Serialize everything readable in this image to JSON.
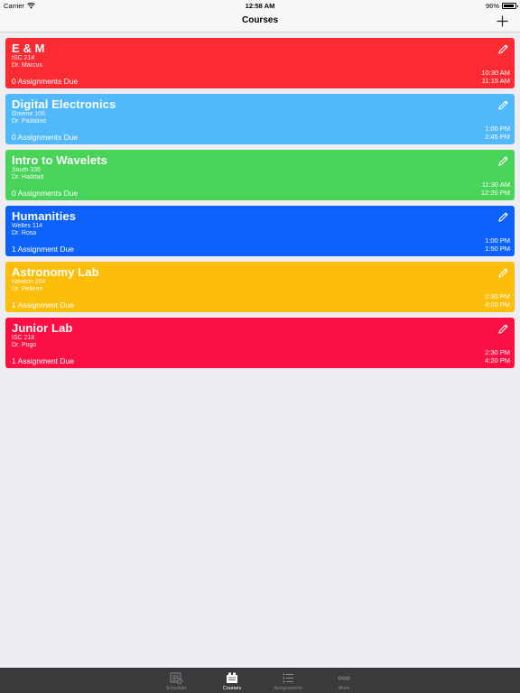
{
  "status": {
    "carrier": "Carrier",
    "time": "12:58 AM",
    "battery": "96%"
  },
  "nav": {
    "title": "Courses",
    "add_icon": "plus-icon"
  },
  "courses": [
    {
      "name": "E & M",
      "room": "ISC 214",
      "professor": "Dr. Marcus",
      "due": "0 Assignments Due",
      "start": "10:30 AM",
      "end": "11:15 AM",
      "color": "#fc2a33"
    },
    {
      "name": "Digital Electronics",
      "room": "Greene 105",
      "professor": "Dr. Padalino",
      "due": "0 Assignments Due",
      "start": "1:00 PM",
      "end": "2:45 PM",
      "color": "#51b8f9"
    },
    {
      "name": "Intro to Wavelets",
      "room": "South 336",
      "professor": "Dr. Haddad",
      "due": "0 Assignments Due",
      "start": "11:30 AM",
      "end": "12:20 PM",
      "color": "#48d359"
    },
    {
      "name": "Humanities",
      "room": "Welles 114",
      "professor": "Dr. Rosa",
      "due": "1 Assignment Due",
      "start": "1:00 PM",
      "end": "1:50 PM",
      "color": "#0e62fc"
    },
    {
      "name": "Astronomy Lab",
      "room": "Newton 204",
      "professor": "Dr. Pellerin",
      "due": "1 Assignment Due",
      "start": "2:30 PM",
      "end": "4:00 PM",
      "color": "#fcbe0a"
    },
    {
      "name": "Junior Lab",
      "room": "ISC 218",
      "professor": "Dr. Pogo",
      "due": "1 Assignment Due",
      "start": "2:30 PM",
      "end": "4:20 PM",
      "color": "#fc1043"
    }
  ],
  "tabs": [
    {
      "label": "Schedule",
      "icon": "schedule-icon",
      "active": false
    },
    {
      "label": "Courses",
      "icon": "courses-icon",
      "active": true
    },
    {
      "label": "Assignments",
      "icon": "assignments-icon",
      "active": false
    },
    {
      "label": "More",
      "icon": "more-icon",
      "active": false
    }
  ]
}
